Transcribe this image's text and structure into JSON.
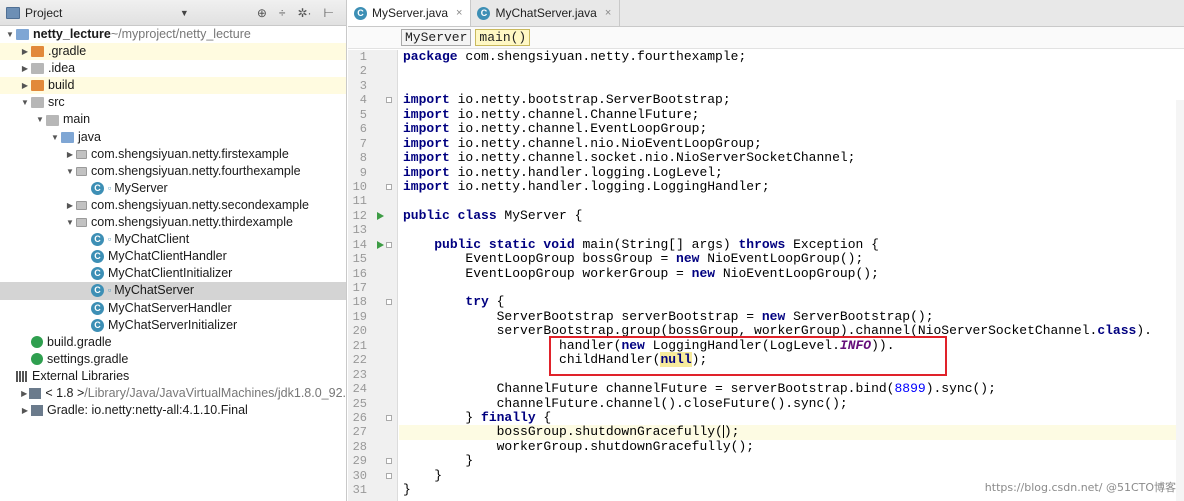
{
  "project_panel": {
    "title": "Project",
    "dropdown": "▼",
    "tools": [
      "⊕",
      "÷",
      "✲·",
      "⊢"
    ],
    "tree": [
      {
        "indent": 0,
        "arrow": "▼",
        "icon": "folder-blue",
        "label": "netty_lecture",
        "suffix": " ~/myproject/netty_lecture",
        "bold": true
      },
      {
        "indent": 1,
        "arrow": "▶",
        "icon": "folder-orange",
        "label": ".gradle",
        "highlight": true
      },
      {
        "indent": 1,
        "arrow": "▶",
        "icon": "folder-gray",
        "label": ".idea"
      },
      {
        "indent": 1,
        "arrow": "▶",
        "icon": "folder-orange",
        "label": "build",
        "highlight": true
      },
      {
        "indent": 1,
        "arrow": "▼",
        "icon": "folder-gray",
        "label": "src"
      },
      {
        "indent": 2,
        "arrow": "▼",
        "icon": "folder-gray",
        "label": "main"
      },
      {
        "indent": 3,
        "arrow": "▼",
        "icon": "folder-src",
        "label": "java"
      },
      {
        "indent": 4,
        "arrow": "▶",
        "icon": "pkg",
        "label": "com.shengsiyuan.netty.firstexample"
      },
      {
        "indent": 4,
        "arrow": "▼",
        "icon": "pkg",
        "label": "com.shengsiyuan.netty.fourthexample"
      },
      {
        "indent": 5,
        "arrow": "",
        "icon": "class",
        "label": "MyServer",
        "badge": "▫"
      },
      {
        "indent": 4,
        "arrow": "▶",
        "icon": "pkg",
        "label": "com.shengsiyuan.netty.secondexample"
      },
      {
        "indent": 4,
        "arrow": "▼",
        "icon": "pkg",
        "label": "com.shengsiyuan.netty.thirdexample"
      },
      {
        "indent": 5,
        "arrow": "",
        "icon": "class",
        "label": "MyChatClient",
        "badge": "▫"
      },
      {
        "indent": 5,
        "arrow": "",
        "icon": "class",
        "label": "MyChatClientHandler"
      },
      {
        "indent": 5,
        "arrow": "",
        "icon": "class",
        "label": "MyChatClientInitializer"
      },
      {
        "indent": 5,
        "arrow": "",
        "icon": "class",
        "label": "MyChatServer",
        "badge": "▫",
        "selected": true
      },
      {
        "indent": 5,
        "arrow": "",
        "icon": "class",
        "label": "MyChatServerHandler"
      },
      {
        "indent": 5,
        "arrow": "",
        "icon": "class",
        "label": "MyChatServerInitializer"
      },
      {
        "indent": 1,
        "arrow": "",
        "icon": "gradle",
        "label": "build.gradle"
      },
      {
        "indent": 1,
        "arrow": "",
        "icon": "gradle",
        "label": "settings.gradle"
      },
      {
        "indent": 0,
        "arrow": "",
        "icon": "libs",
        "label": "External Libraries"
      },
      {
        "indent": 1,
        "arrow": "▶",
        "icon": "jdk",
        "label": "< 1.8 >",
        "suffix": " /Library/Java/JavaVirtualMachines/jdk1.8.0_92."
      },
      {
        "indent": 1,
        "arrow": "▶",
        "icon": "jdk",
        "label": "Gradle: io.netty:netty-all:4.1.10.Final"
      }
    ]
  },
  "editor": {
    "tabs": [
      {
        "label": "MyServer.java",
        "active": true,
        "close": "×"
      },
      {
        "label": "MyChatServer.java",
        "active": false,
        "close": "×"
      }
    ],
    "breadcrumbs": [
      "MyServer",
      "main()"
    ],
    "watermark": "https://blog.csdn.net/ @51CTO博客",
    "code_lines": [
      {
        "n": "1",
        "html": "<span class=\"kw\">package</span> com.shengsiyuan.netty.fourthexample;"
      },
      {
        "n": "2",
        "html": ""
      },
      {
        "n": "3",
        "html": ""
      },
      {
        "n": "4",
        "html": "<span class=\"kw\">import</span> io.netty.bootstrap.ServerBootstrap;",
        "fold": true
      },
      {
        "n": "5",
        "html": "<span class=\"kw\">import</span> io.netty.channel.ChannelFuture;"
      },
      {
        "n": "6",
        "html": "<span class=\"kw\">import</span> io.netty.channel.EventLoopGroup;"
      },
      {
        "n": "7",
        "html": "<span class=\"kw\">import</span> io.netty.channel.nio.NioEventLoopGroup;"
      },
      {
        "n": "8",
        "html": "<span class=\"kw\">import</span> io.netty.channel.socket.nio.NioServerSocketChannel;"
      },
      {
        "n": "9",
        "html": "<span class=\"kw\">import</span> io.netty.handler.logging.LogLevel;"
      },
      {
        "n": "10",
        "html": "<span class=\"kw\">import</span> io.netty.handler.logging.LoggingHandler;",
        "fold": true
      },
      {
        "n": "11",
        "html": ""
      },
      {
        "n": "12",
        "html": "<span class=\"kw\">public class</span> MyServer {",
        "run": true
      },
      {
        "n": "13",
        "html": ""
      },
      {
        "n": "14",
        "html": "    <span class=\"kw\">public static void</span> main(String[] args) <span class=\"kw\">throws</span> Exception {",
        "run": true,
        "fold": true
      },
      {
        "n": "15",
        "html": "        EventLoopGroup bossGroup = <span class=\"kw\">new</span> NioEventLoopGroup();"
      },
      {
        "n": "16",
        "html": "        EventLoopGroup workerGroup = <span class=\"kw\">new</span> NioEventLoopGroup();"
      },
      {
        "n": "17",
        "html": ""
      },
      {
        "n": "18",
        "html": "        <span class=\"kw\">try</span> {",
        "fold": true
      },
      {
        "n": "19",
        "html": "            ServerBootstrap serverBootstrap = <span class=\"kw\">new</span> ServerBootstrap();"
      },
      {
        "n": "20",
        "html": "            serverBootstrap.group(bossGroup, workerGroup).channel(NioServerSocketChannel.<span class=\"kw\">class</span>)."
      },
      {
        "n": "21",
        "html": "                    handler(<span class=\"kw\">new</span> LoggingHandler(LogLevel.<span class=\"const\">INFO</span>))."
      },
      {
        "n": "22",
        "html": "                    childHandler(<span class=\"null-hl\"><span class=\"kw\">null</span></span>);"
      },
      {
        "n": "23",
        "html": ""
      },
      {
        "n": "24",
        "html": "            ChannelFuture channelFuture = serverBootstrap.bind(<span class=\"num-lit\">8899</span>).sync();"
      },
      {
        "n": "25",
        "html": "            channelFuture.channel().closeFuture().sync();"
      },
      {
        "n": "26",
        "html": "        } <span class=\"kw\">finally</span> {",
        "fold": true
      },
      {
        "n": "27",
        "html": "            bossGroup.shutdownGracefully(<span class=\"caret\"></span>);",
        "current": true
      },
      {
        "n": "28",
        "html": "            workerGroup.shutdownGracefully();"
      },
      {
        "n": "29",
        "html": "        }",
        "fold": true
      },
      {
        "n": "30",
        "html": "    }",
        "fold": true
      },
      {
        "n": "31",
        "html": "}"
      }
    ]
  }
}
